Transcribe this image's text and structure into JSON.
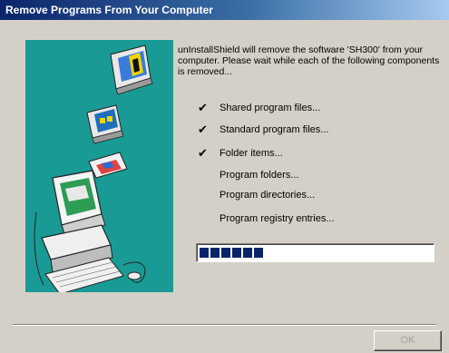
{
  "window": {
    "title": "Remove Programs From Your Computer"
  },
  "intro": "unInstallShield will remove the software 'SH300' from your computer.  Please wait while each of the following components is removed...",
  "items": [
    {
      "label": "Shared program files...",
      "done": true,
      "check": "✔"
    },
    {
      "label": "Standard program files...",
      "done": true,
      "check": "✔"
    },
    {
      "label": "Folder items...",
      "done": true,
      "check": "✔"
    },
    {
      "label": "Program folders...",
      "done": false,
      "check": ""
    },
    {
      "label": "Program directories...",
      "done": false,
      "check": ""
    },
    {
      "label": "Program registry entries...",
      "done": false,
      "check": ""
    }
  ],
  "progress": {
    "blocks_filled": 6
  },
  "buttons": {
    "ok": "OK"
  },
  "colors": {
    "titlebar_start": "#0a246a",
    "art_background": "#1a9a94",
    "progress_block": "#0a246a",
    "dialog_face": "#d4d0c8"
  }
}
